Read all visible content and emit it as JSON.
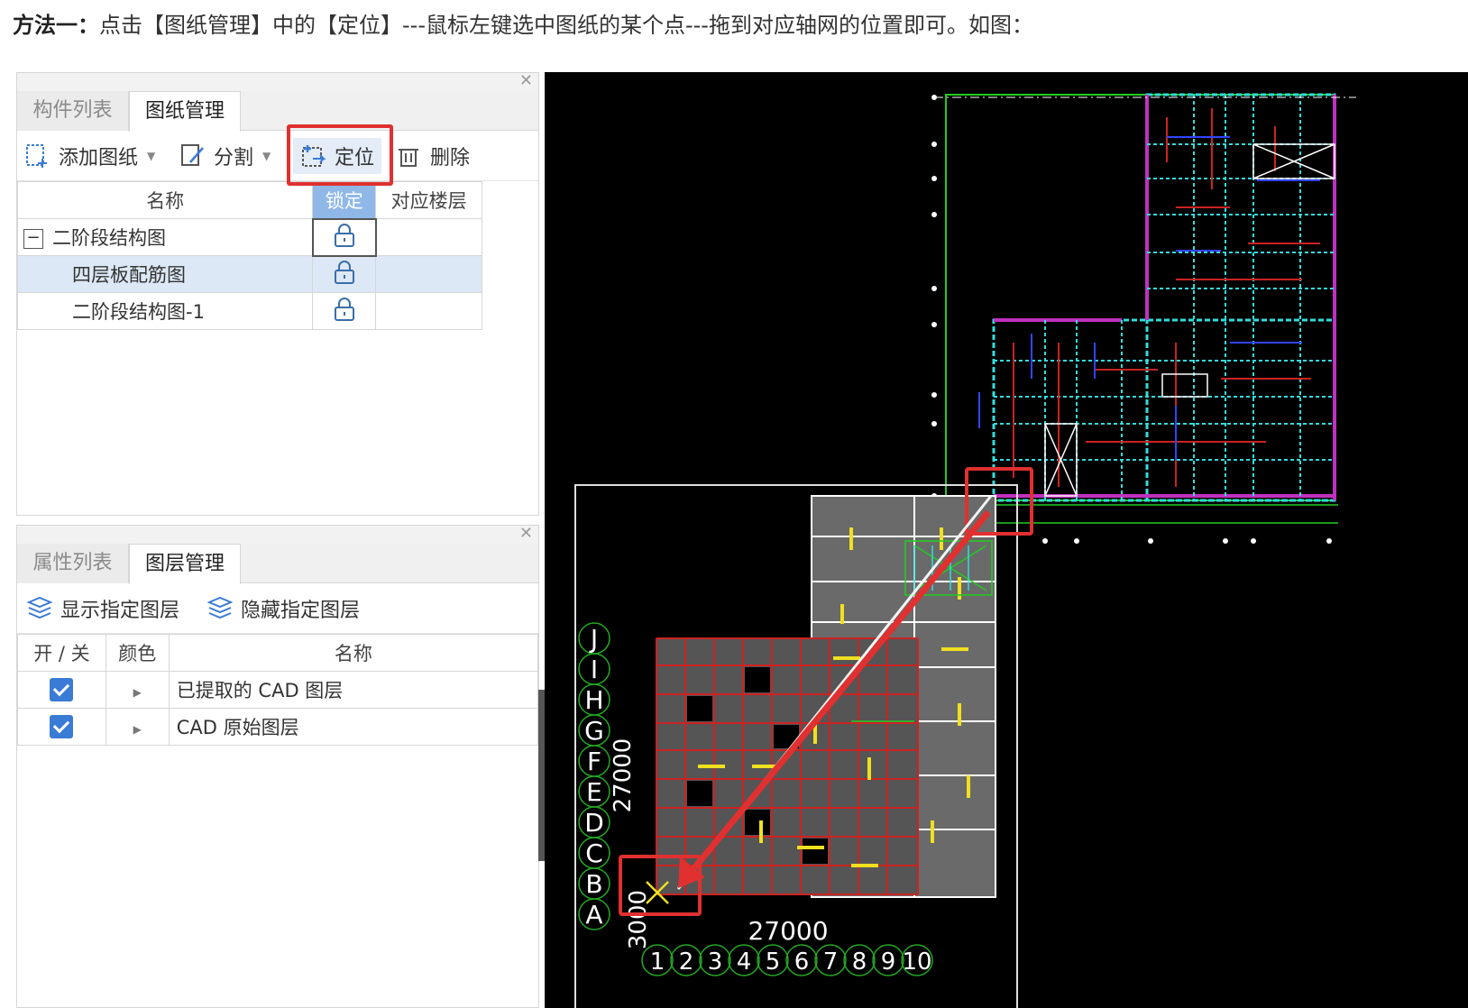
{
  "caption": {
    "method": "方法一：",
    "text": "点击【图纸管理】中的【定位】---鼠标左键选中图纸的某个点---拖到对应轴网的位置即可。如图："
  },
  "top_panel": {
    "tabs": [
      "构件列表",
      "图纸管理"
    ],
    "active_tab": "图纸管理",
    "toolbar": {
      "add_drawing": "添加图纸",
      "split": "分割",
      "locate": "定位",
      "delete": "删除"
    },
    "table": {
      "headers": [
        "名称",
        "锁定",
        "对应楼层"
      ],
      "rows": [
        {
          "name": "二阶段结构图",
          "expand": "−",
          "floor": ""
        },
        {
          "name": "四层板配筋图",
          "floor": ""
        },
        {
          "name": "二阶段结构图-1",
          "floor": ""
        }
      ]
    }
  },
  "bottom_panel": {
    "tabs": [
      "属性列表",
      "图层管理"
    ],
    "active_tab": "图层管理",
    "toolbar": {
      "show_layer": "显示指定图层",
      "hide_layer": "隐藏指定图层"
    },
    "table": {
      "headers": [
        "开 / 关",
        "颜色",
        "名称"
      ],
      "rows": [
        {
          "checked": true,
          "name": "已提取的 CAD 图层"
        },
        {
          "checked": true,
          "name": "CAD 原始图层"
        }
      ]
    }
  },
  "cad_view": {
    "axis_letters": [
      "J",
      "I",
      "H",
      "G",
      "F",
      "E",
      "D",
      "C",
      "B",
      "A"
    ],
    "axis_numbers": [
      "1",
      "2",
      "3",
      "4",
      "5",
      "6",
      "7",
      "8",
      "9",
      "10"
    ],
    "total_dimension": "27000",
    "span_label": "3000",
    "colors": {
      "background": "#000000",
      "arrow": "#e03030",
      "grid_red": "#cc2222",
      "green": "#22cc22",
      "cyan": "#33dddd",
      "magenta": "#c030c0",
      "yellow": "#f0e020"
    }
  }
}
